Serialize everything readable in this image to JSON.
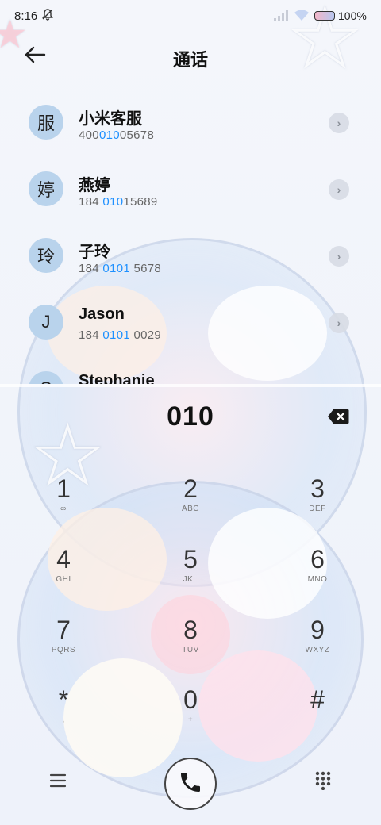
{
  "status_bar": {
    "time": "8:16",
    "battery": "100%",
    "icons": [
      "bell-off-icon",
      "signal-icon",
      "wifi-icon",
      "battery-icon"
    ]
  },
  "header": {
    "title": "通话",
    "back_icon": "back-arrow-icon"
  },
  "contacts": [
    {
      "avatar": "服",
      "name": "小米客服",
      "number_pre": "400",
      "number_hl": "010",
      "number_post": "05678"
    },
    {
      "avatar": "婷",
      "name": "燕婷",
      "number_pre": "184 ",
      "number_hl": "010",
      "number_post": "15689"
    },
    {
      "avatar": "玲",
      "name": "子玲",
      "number_pre": "184 ",
      "number_hl": "0101",
      "number_post": " 5678"
    },
    {
      "avatar": "J",
      "name": "Jason",
      "number_pre": "184 ",
      "number_hl": "0101",
      "number_post": " 0029"
    },
    {
      "avatar": "S",
      "name": "Stephanie",
      "number_pre": "",
      "number_hl": "",
      "number_post": ""
    }
  ],
  "dialer": {
    "input_value": "010",
    "keys": [
      {
        "digit": "1",
        "sub": "∞"
      },
      {
        "digit": "2",
        "sub": "ABC"
      },
      {
        "digit": "3",
        "sub": "DEF"
      },
      {
        "digit": "4",
        "sub": "GHI"
      },
      {
        "digit": "5",
        "sub": "JKL"
      },
      {
        "digit": "6",
        "sub": "MNO"
      },
      {
        "digit": "7",
        "sub": "PQRS"
      },
      {
        "digit": "8",
        "sub": "TUV"
      },
      {
        "digit": "9",
        "sub": "WXYZ"
      },
      {
        "digit": "*",
        "sub": ","
      },
      {
        "digit": "0",
        "sub": "+"
      },
      {
        "digit": "#",
        "sub": ""
      }
    ]
  },
  "bottom_bar": {
    "menu_icon": "menu-icon",
    "call_icon": "phone-icon",
    "keypad_icon": "keypad-icon"
  },
  "colors": {
    "highlight": "#1e90ff",
    "avatar_bg": "#b9d3ec"
  }
}
